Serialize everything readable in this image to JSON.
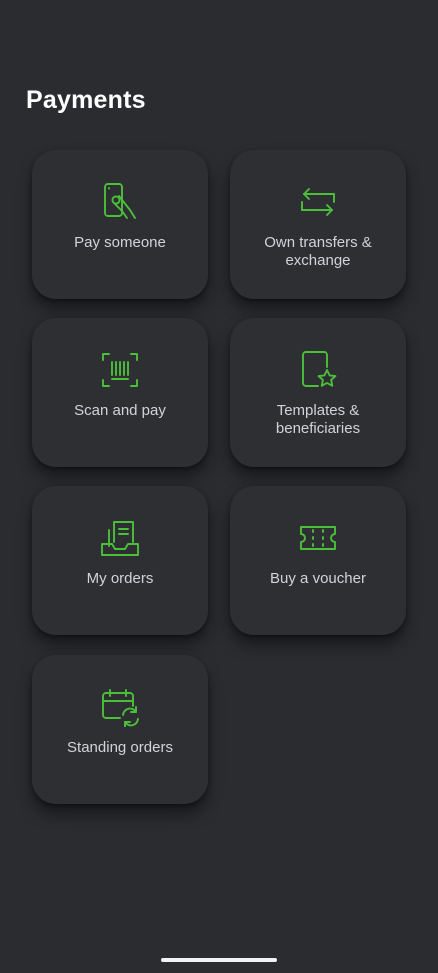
{
  "header": {
    "title": "Payments"
  },
  "colors": {
    "background": "#2b2c30",
    "tile": "#2e2f33",
    "accent": "#4cbf3a",
    "label": "#d2d3d8",
    "title": "#ffffff"
  },
  "tiles": [
    {
      "icon": "phone-hand-icon",
      "label": "Pay someone"
    },
    {
      "icon": "transfer-arrows-icon",
      "label": "Own transfers & exchange"
    },
    {
      "icon": "barcode-scan-icon",
      "label": "Scan and pay"
    },
    {
      "icon": "tablet-star-icon",
      "label": "Templates & beneficiaries"
    },
    {
      "icon": "inbox-document-icon",
      "label": "My orders"
    },
    {
      "icon": "ticket-icon",
      "label": "Buy a voucher"
    },
    {
      "icon": "calendar-refresh-icon",
      "label": "Standing orders"
    }
  ]
}
